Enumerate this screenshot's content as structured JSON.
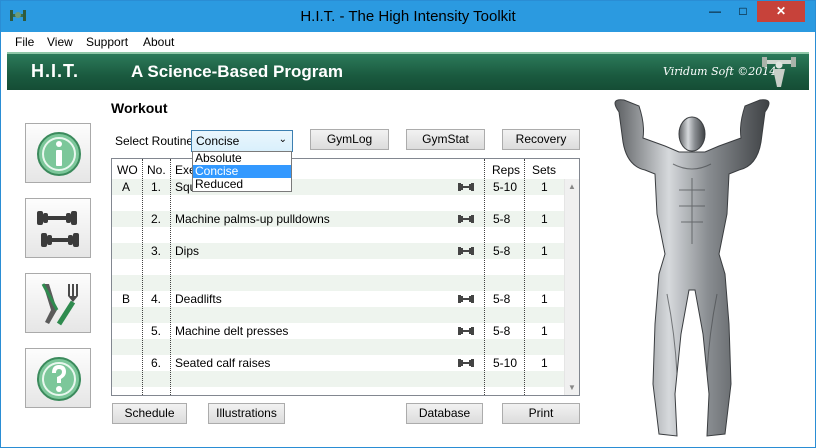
{
  "window": {
    "title": "H.I.T. - The High Intensity Toolkit",
    "min_glyph": "—",
    "max_glyph": "□",
    "close_glyph": "✕"
  },
  "menu": [
    "File",
    "View",
    "Support",
    "About"
  ],
  "banner": {
    "hit": "H.I.T.",
    "slogan": "A Science-Based Program",
    "company": "Viridum Soft ©2014"
  },
  "sidebar": [
    {
      "name": "info-icon"
    },
    {
      "name": "dumbbells-icon"
    },
    {
      "name": "fork-knife-icon"
    },
    {
      "name": "help-icon"
    }
  ],
  "workout": {
    "title": "Workout",
    "routine_label": "Select Routine:",
    "routine_value": "Concise",
    "routine_options": [
      "Absolute",
      "Concise",
      "Reduced"
    ],
    "buttons": {
      "gymlog": "GymLog",
      "gymstat": "GymStat",
      "recovery": "Recovery"
    }
  },
  "table": {
    "headers": {
      "wo": "WO",
      "no": "No.",
      "exercise": "Exe",
      "reps": "Reps",
      "sets": "Sets"
    },
    "rows": [
      {
        "wo": "A",
        "no": "1.",
        "exercise": "Squ",
        "reps": "5-10",
        "sets": "1"
      },
      {
        "wo": "",
        "no": "2.",
        "exercise": "Machine palms-up pulldowns",
        "reps": "5-8",
        "sets": "1"
      },
      {
        "wo": "",
        "no": "3.",
        "exercise": "Dips",
        "reps": "5-8",
        "sets": "1"
      },
      {
        "wo": "B",
        "no": "4.",
        "exercise": "Deadlifts",
        "reps": "5-8",
        "sets": "1"
      },
      {
        "wo": "",
        "no": "5.",
        "exercise": "Machine delt presses",
        "reps": "5-8",
        "sets": "1"
      },
      {
        "wo": "",
        "no": "6.",
        "exercise": "Seated calf raises",
        "reps": "5-10",
        "sets": "1"
      }
    ]
  },
  "bottom_buttons": {
    "schedule": "Schedule",
    "illustrations": "Illustrations",
    "database": "Database",
    "print": "Print"
  },
  "colors": {
    "title_bar": "#2b9ae0",
    "banner": "#1a5a3f",
    "close_button": "#c7423a",
    "selection": "#3399ff"
  }
}
